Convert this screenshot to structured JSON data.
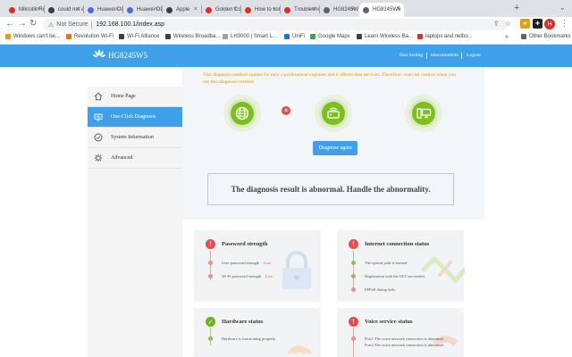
{
  "browser": {
    "tabs": [
      {
        "title": "Mikrotik Ro",
        "fav_color": "#d93025"
      },
      {
        "title": "could not e",
        "fav_color": "#3c4043"
      },
      {
        "title": "Huawei OLT",
        "fav_color": "#4a6cd4"
      },
      {
        "title": "Huawei OLT",
        "fav_color": "#4a6cd4"
      },
      {
        "title": "Apple",
        "fav_color": "#3c4043"
      },
      {
        "title": "Golden Cou",
        "fav_color": "#d93025"
      },
      {
        "title": "How to conf",
        "fav_color": "#d93025"
      },
      {
        "title": "Troublesho",
        "fav_color": "#d93025"
      },
      {
        "title": "HG8245W5",
        "fav_color": "#5f6368"
      },
      {
        "title": "HG8245W5",
        "fav_color": "#5f6368"
      }
    ],
    "address": {
      "security": "Not Secure",
      "url": "192.168.100.1/index.asp"
    },
    "avatar_letter": "H",
    "bookmarks": [
      {
        "label": "Windows can't be...",
        "color": "#f29900"
      },
      {
        "label": "Revolution Wi-Fi",
        "color": "#e8710a"
      },
      {
        "label": "Wi-Fi Alliance",
        "color": "#3c4043"
      },
      {
        "label": "Wireless Broadba...",
        "color": "#3c4043"
      },
      {
        "label": "LH3000 | Smart L...",
        "color": "#9aa0a6"
      },
      {
        "label": "UniFi",
        "color": "#1a73e8"
      },
      {
        "label": "Google Maps",
        "color": "#34a853"
      },
      {
        "label": "Learn Wireless Ba...",
        "color": "#3c4043"
      },
      {
        "label": "laptops and netbo...",
        "color": "#d93025"
      }
    ],
    "other_bookmarks": "Other Bookmarks"
  },
  "header": {
    "logo": "HG8245W5",
    "links": [
      "Fast Setting",
      "telecomadmin",
      "Logout"
    ]
  },
  "sidebar": {
    "items": [
      {
        "label": "Home Page",
        "icon": "home-icon"
      },
      {
        "label": "One-Click Diagnosis",
        "icon": "diagnosis-icon",
        "active": true
      },
      {
        "label": "System Information",
        "icon": "info-icon"
      },
      {
        "label": "Advanced",
        "icon": "gear-icon"
      }
    ]
  },
  "diagnosis": {
    "warning": "This diagnosis method applies for only a professional engineer and it affects data services. Therefore, exercise caution when you use this diagnosis method.",
    "button": "Diagnose again",
    "result": "The diagnosis result is abnormal. Handle the abnormality."
  },
  "cards": {
    "password": {
      "title": "Password strength",
      "rows": [
        {
          "text": "User password strength",
          "value": "Low"
        },
        {
          "text": "Wi-Fi password strength",
          "value": "Low"
        }
      ]
    },
    "internet": {
      "title": "Internet connection status",
      "rows": [
        "The optical path is normal.",
        "Registration with the OLT succeeded.",
        "PPPoE dialup fails."
      ]
    },
    "hardware": {
      "title": "Hardware status",
      "rows": [
        "Hardware is functioning properly."
      ]
    },
    "voice": {
      "title": "Voice service status",
      "rows": [
        "Port1:The voice network connection is abnormal.",
        "Port2:The voice network connection is abnormal."
      ]
    }
  },
  "colors": {
    "brand_blue": "#3fa0e8",
    "ok_green": "#7cbf1e",
    "error_red": "#e84c4c",
    "warning_orange": "#e8900c"
  }
}
